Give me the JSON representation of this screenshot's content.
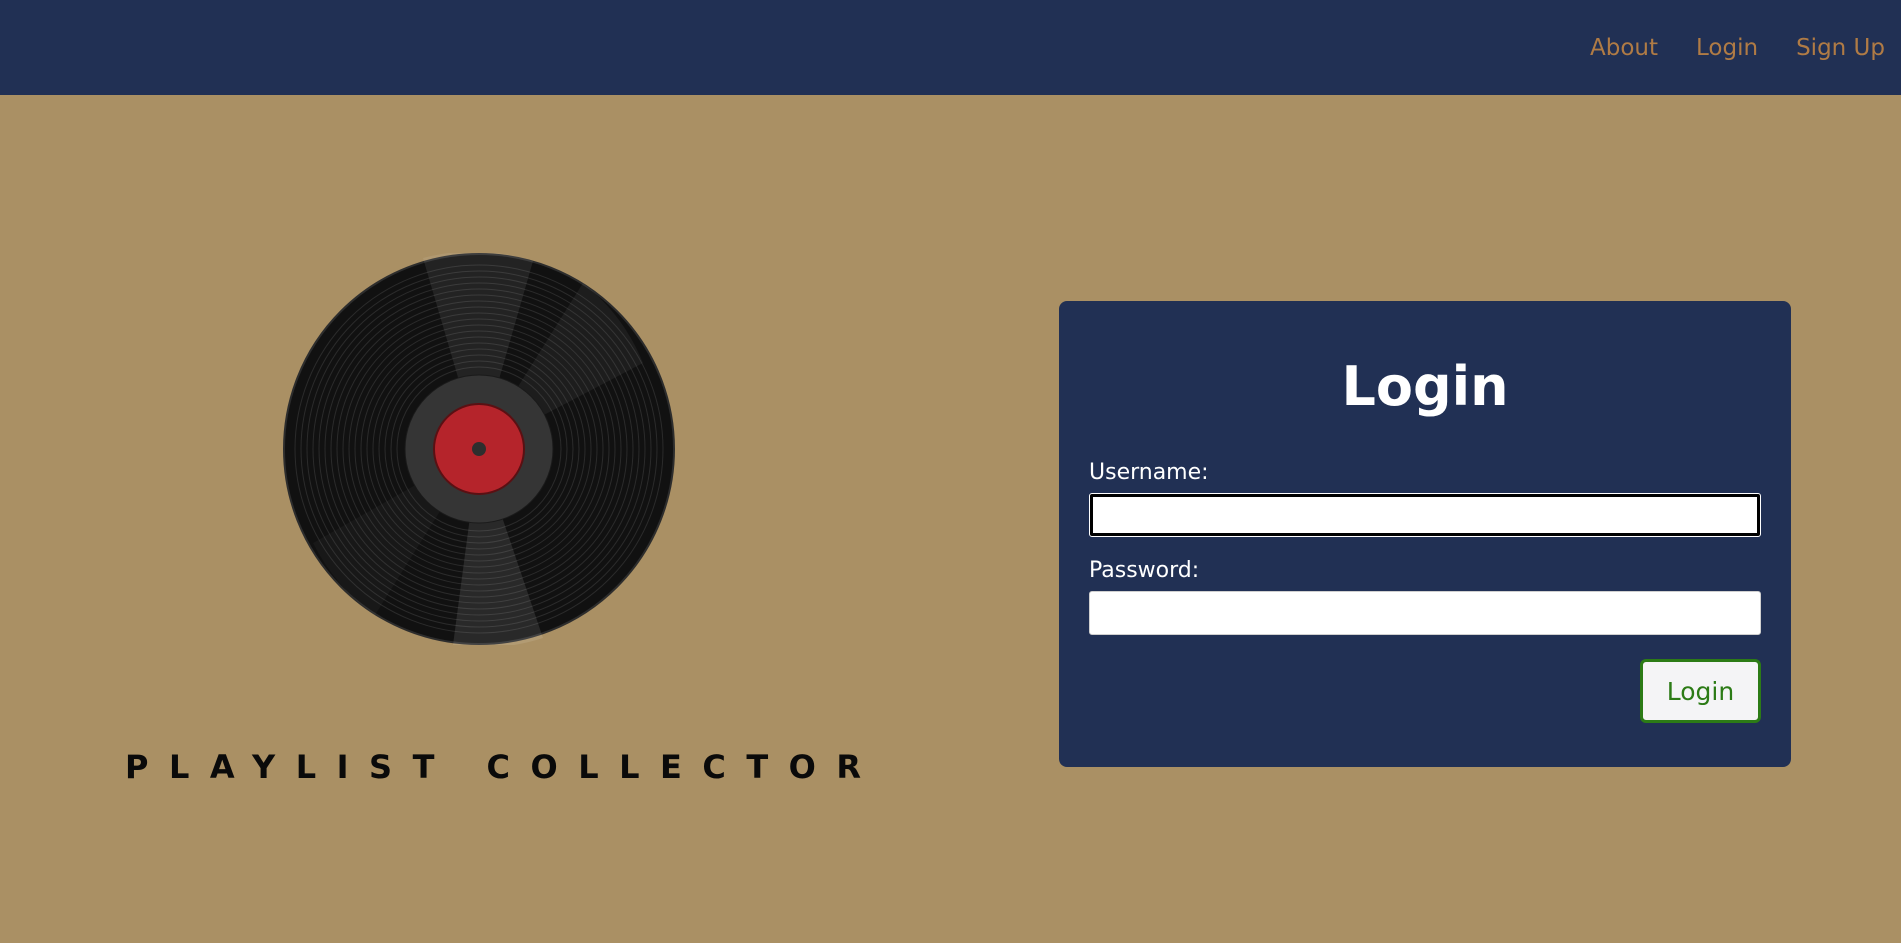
{
  "nav": {
    "links": [
      {
        "label": "About"
      },
      {
        "label": "Login"
      },
      {
        "label": "Sign Up"
      }
    ]
  },
  "brand": {
    "name": "PLAYLIST COLLECTOR"
  },
  "login_form": {
    "title": "Login",
    "username_label": "Username:",
    "username_value": "",
    "password_label": "Password:",
    "password_value": "",
    "submit_label": "Login"
  },
  "colors": {
    "page_background": "#aa9064",
    "navbar": "#213054",
    "nav_link": "#b07b45",
    "card": "#213054",
    "record_label": "#b5242b",
    "button_text": "#2c7b16"
  }
}
